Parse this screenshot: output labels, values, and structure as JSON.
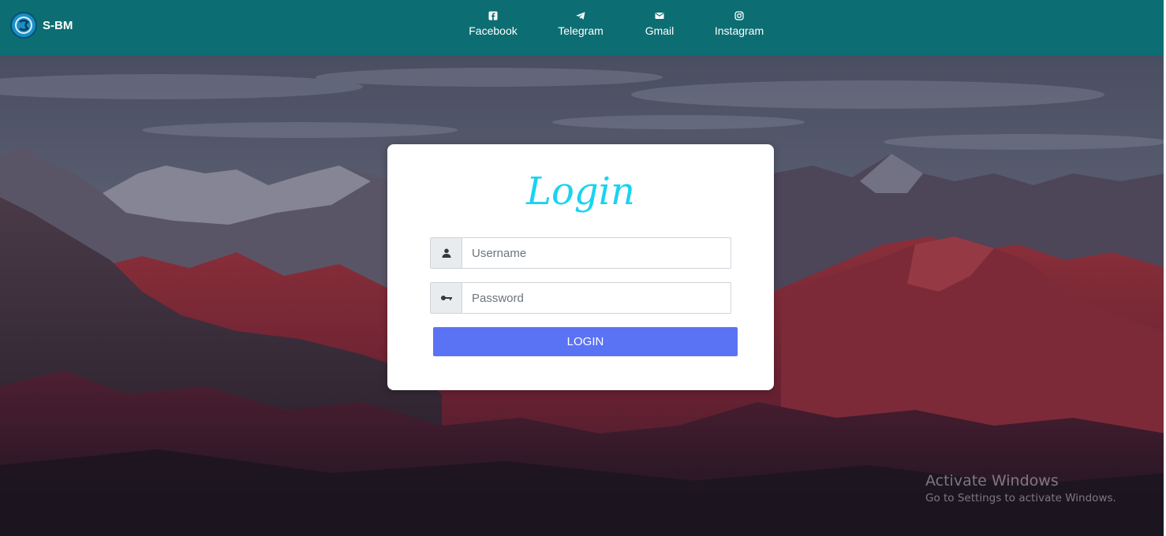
{
  "navbar": {
    "brand": "S-BM",
    "links": [
      {
        "label": "Facebook",
        "icon": "facebook-icon"
      },
      {
        "label": "Telegram",
        "icon": "telegram-icon"
      },
      {
        "label": "Gmail",
        "icon": "gmail-icon"
      },
      {
        "label": "Instagram",
        "icon": "instagram-icon"
      }
    ]
  },
  "login": {
    "title": "Login",
    "username_placeholder": "Username",
    "password_placeholder": "Password",
    "username_icon": "user-icon",
    "password_icon": "key-icon",
    "button_label": "LOGIN"
  },
  "watermark": {
    "title": "Activate Windows",
    "subtitle": "Go to Settings to activate Windows."
  },
  "colors": {
    "navbar": "#0c6e72",
    "title": "#19d3f0",
    "button": "#5a73f5",
    "card": "#ffffff"
  }
}
